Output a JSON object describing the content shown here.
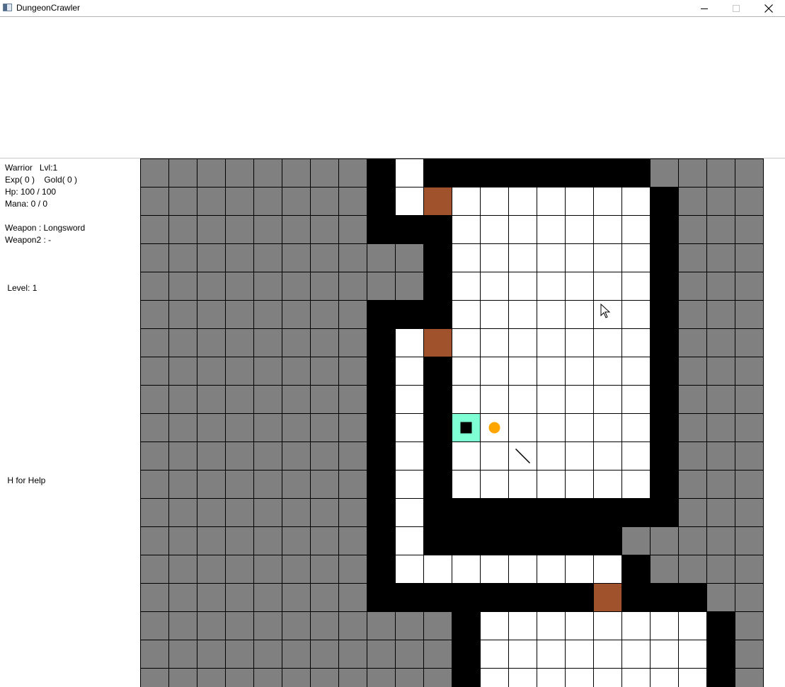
{
  "window": {
    "title": "DungeonCrawler",
    "minimize_label": "Minimize",
    "maximize_label": "Maximize",
    "close_label": "Close"
  },
  "stats": {
    "class_line": "Warrior   Lvl:1",
    "exp_gold_line": "Exp( 0 )    Gold( 0 )",
    "hp_line": "Hp: 100 / 100",
    "mana_line": "Mana: 0 / 0",
    "weapon_line": "Weapon : Longsword",
    "weapon2_line": "Weapon2 : -",
    "level_line": " Level: 1",
    "help_line": " H for Help"
  },
  "colors": {
    "unexplored": "#808080",
    "wall": "#000000",
    "floor": "#ffffff",
    "door": "#a0522d",
    "player_tile": "#7fffd4",
    "player_marker": "#000000",
    "gold": "#ffa500",
    "grid_line": "#000000"
  },
  "map": {
    "legend": {
      "G": "unexplored",
      "W": "wall",
      ".": "floor",
      "D": "door",
      "P": "player",
      "o": "gold-coin",
      "/": "weapon-item"
    },
    "rows": [
      "GGGGGGGGW.WWWWWWWWGGGG",
      "GGGGGGGGW.D.......WGGG",
      "GGGGGGGGWWW.......WGGG",
      "GGGGGGGGGGW.......WGGG",
      "GGGGGGGGGGW.......WGGG",
      "GGGGGGGGWWW.......WGGG",
      "GGGGGGGGW.D.......WGGG",
      "GGGGGGGGW.W.......WGGG",
      "GGGGGGGGW.W.......WGGG",
      "GGGGGGGGW.WPo.....WGGG",
      "GGGGGGGGW.W../....WGGG",
      "GGGGGGGGW.W.......WGGG",
      "GGGGGGGGW.WWWWWWWWWGGG",
      "GGGGGGGGW.WWWWWWWGGGGG",
      "GGGGGGGGW........WGGGG",
      "GGGGGGGGWWWWWWWWDWWWGG",
      "GGGGGGGGGGGW........WG",
      "GGGGGGGGGGGW........WG",
      "GGGGGGGGGGGW........WG"
    ]
  }
}
